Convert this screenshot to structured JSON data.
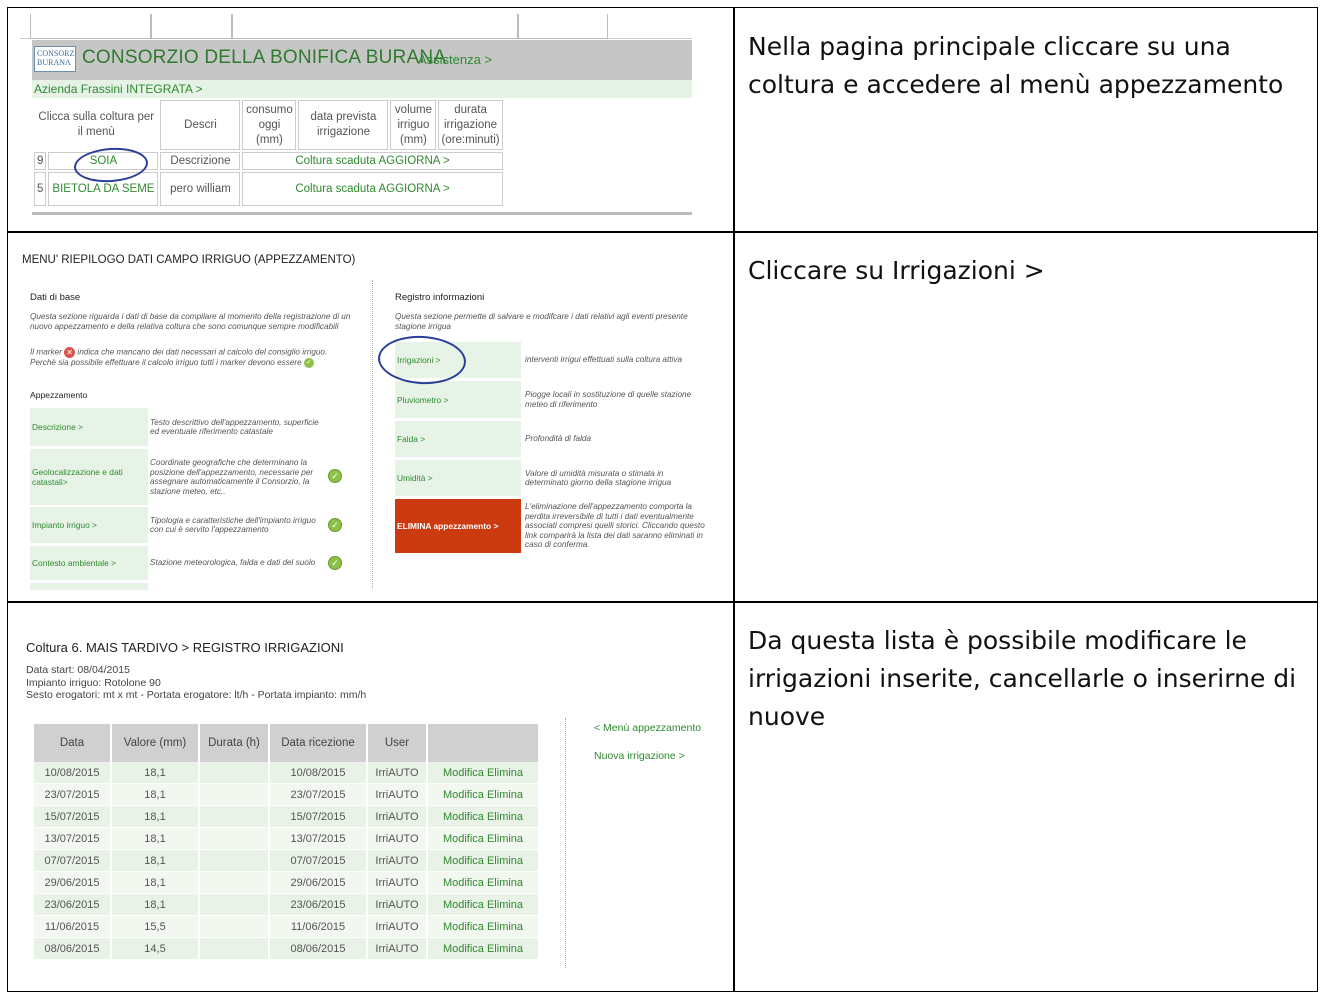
{
  "captions": {
    "step1": "Nella pagina principale cliccare su una coltura e accedere al menù appezzamento",
    "step2": "Cliccare su Irrigazioni >",
    "step3": "Da questa lista è possibile modificare le irrigazioni inserite, cancellarle o inserirne di nuove"
  },
  "panel1": {
    "logo_text": "CONSORZIO BURANA",
    "brand": "CONSORZIO DELLA BONIFICA BURANA",
    "assistance": "Assistenza >",
    "company": "Azienda Frassini INTEGRATA >",
    "headers": [
      "Clicca sulla coltura per il menù",
      "Descri",
      "consumo oggi (mm)",
      "data prevista irrigazione",
      "volume irriguo (mm)",
      "durata irrigazione (ore:minuti)"
    ],
    "rows": [
      {
        "num": "9",
        "crop": "SOIA",
        "descr": "Descrizione",
        "status": "Coltura scaduta AGGIORNA >"
      },
      {
        "num": "5",
        "crop": "BIETOLA DA SEME",
        "descr": "pero william",
        "status": "Coltura scaduta AGGIORNA >"
      }
    ]
  },
  "panel2": {
    "title": "MENU' RIEPILOGO DATI CAMPO IRRIGUO (APPEZZAMENTO)",
    "base_title": "Dati di base",
    "base_desc1": "Questa sezione riguarda i dati di base da compilare al momento della registrazione di un nuovo appezzamento e della relativa coltura che sono comunque sempre modificabili",
    "base_desc2a": "Il marker",
    "base_desc2b": "indica che mancano dei dati necessari al calcolo del consiglio irriguo. Perchè sia possibile effettuare il calcolo irriguo tutti i marker devono essere",
    "app_title": "Appezzamento",
    "app_rows": [
      {
        "label": "Descrizione >",
        "desc": "Testo descrittivo dell'appezzamento, superficie ed eventuale riferimento catastale"
      },
      {
        "label": "Geolocalizzazione e dati catastali>",
        "desc": "Coordinate geografiche che determinano la posizione dell'appezzamento, necessarie per assegnare automaticamente il Consorzio, la stazione meteo, etc.."
      },
      {
        "label": "Impianto irriguo >",
        "desc": "Tipologia e caratteristiche dell'impianto irriguo con cui è servito l'appezzamento"
      },
      {
        "label": "Contesto ambientale >",
        "desc": "Stazione meteorologica, falda e dati del suolo"
      }
    ],
    "reg_title": "Registro informazioni",
    "reg_desc": "Questa sezione permette di salvare e modifcare i dati relativi agli eventi presente stagione irrigua",
    "reg_rows": [
      {
        "label": "Irrigazioni >",
        "desc": "interventi irrigui effettuati sulla coltura attiva"
      },
      {
        "label": "Pluviometro >",
        "desc": "Piogge locali in sostituzione di quelle stazione meteo di riferimento"
      },
      {
        "label": "Falda >",
        "desc": "Profondità di falda"
      },
      {
        "label": "Umidità >",
        "desc": "Valore di umidità misurata o stimata in determinato giorno della stagione irrigua"
      },
      {
        "label": "ELIMINA appezzamento >",
        "desc": "L'eliminazione dell'appezzamento comporta la perdita irreversibile di tutti i dati eventualmente associati compresi quelli storici. Cliccando questo link comparirà la lista dei dati saranno eliminati in caso di conferma."
      }
    ]
  },
  "panel3": {
    "title": "Coltura 6. MAIS TARDIVO > REGISTRO IRRIGAZIONI",
    "meta1": "Data start: 08/04/2015",
    "meta2": "Impianto irriguo: Rotolone 90",
    "meta3": "Sesto erogatori: mt x mt - Portata erogatore: lt/h - Portata impianto: mm/h",
    "headers": [
      "Data",
      "Valore (mm)",
      "Durata (h)",
      "Data ricezione",
      "User",
      ""
    ],
    "rows": [
      {
        "data": "10/08/2015",
        "valore": "18,1",
        "durata": "",
        "ricezione": "10/08/2015",
        "user": "IrriAUTO",
        "modifica": "Modifica",
        "elimina": "Elimina"
      },
      {
        "data": "23/07/2015",
        "valore": "18,1",
        "durata": "",
        "ricezione": "23/07/2015",
        "user": "IrriAUTO",
        "modifica": "Modifica",
        "elimina": "Elimina"
      },
      {
        "data": "15/07/2015",
        "valore": "18,1",
        "durata": "",
        "ricezione": "15/07/2015",
        "user": "IrriAUTO",
        "modifica": "Modifica",
        "elimina": "Elimina"
      },
      {
        "data": "13/07/2015",
        "valore": "18,1",
        "durata": "",
        "ricezione": "13/07/2015",
        "user": "IrriAUTO",
        "modifica": "Modifica",
        "elimina": "Elimina"
      },
      {
        "data": "07/07/2015",
        "valore": "18,1",
        "durata": "",
        "ricezione": "07/07/2015",
        "user": "IrriAUTO",
        "modifica": "Modifica",
        "elimina": "Elimina"
      },
      {
        "data": "29/06/2015",
        "valore": "18,1",
        "durata": "",
        "ricezione": "29/06/2015",
        "user": "IrriAUTO",
        "modifica": "Modifica",
        "elimina": "Elimina"
      },
      {
        "data": "23/06/2015",
        "valore": "18,1",
        "durata": "",
        "ricezione": "23/06/2015",
        "user": "IrriAUTO",
        "modifica": "Modifica",
        "elimina": "Elimina"
      },
      {
        "data": "11/06/2015",
        "valore": "15,5",
        "durata": "",
        "ricezione": "11/06/2015",
        "user": "IrriAUTO",
        "modifica": "Modifica",
        "elimina": "Elimina"
      },
      {
        "data": "08/06/2015",
        "valore": "14,5",
        "durata": "",
        "ricezione": "08/06/2015",
        "user": "IrriAUTO",
        "modifica": "Modifica",
        "elimina": "Elimina"
      }
    ],
    "back_link": "< Menù appezzamento",
    "new_link": "Nuova irrigazione >"
  }
}
